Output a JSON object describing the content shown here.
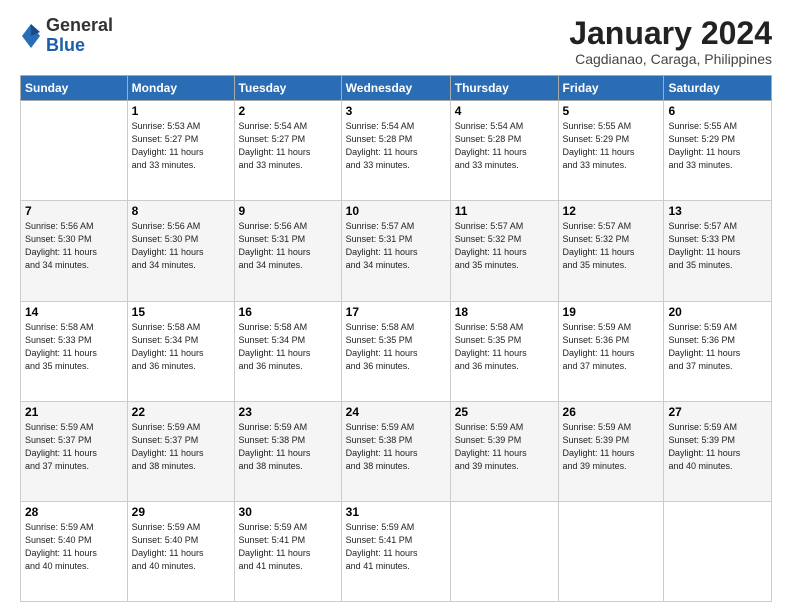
{
  "logo": {
    "general": "General",
    "blue": "Blue"
  },
  "header": {
    "month_year": "January 2024",
    "location": "Cagdianao, Caraga, Philippines"
  },
  "days_of_week": [
    "Sunday",
    "Monday",
    "Tuesday",
    "Wednesday",
    "Thursday",
    "Friday",
    "Saturday"
  ],
  "weeks": [
    [
      {
        "day": "",
        "sunrise": "",
        "sunset": "",
        "daylight": ""
      },
      {
        "day": "1",
        "sunrise": "Sunrise: 5:53 AM",
        "sunset": "Sunset: 5:27 PM",
        "daylight": "Daylight: 11 hours and 33 minutes."
      },
      {
        "day": "2",
        "sunrise": "Sunrise: 5:54 AM",
        "sunset": "Sunset: 5:27 PM",
        "daylight": "Daylight: 11 hours and 33 minutes."
      },
      {
        "day": "3",
        "sunrise": "Sunrise: 5:54 AM",
        "sunset": "Sunset: 5:28 PM",
        "daylight": "Daylight: 11 hours and 33 minutes."
      },
      {
        "day": "4",
        "sunrise": "Sunrise: 5:54 AM",
        "sunset": "Sunset: 5:28 PM",
        "daylight": "Daylight: 11 hours and 33 minutes."
      },
      {
        "day": "5",
        "sunrise": "Sunrise: 5:55 AM",
        "sunset": "Sunset: 5:29 PM",
        "daylight": "Daylight: 11 hours and 33 minutes."
      },
      {
        "day": "6",
        "sunrise": "Sunrise: 5:55 AM",
        "sunset": "Sunset: 5:29 PM",
        "daylight": "Daylight: 11 hours and 33 minutes."
      }
    ],
    [
      {
        "day": "7",
        "sunrise": "Sunrise: 5:56 AM",
        "sunset": "Sunset: 5:30 PM",
        "daylight": "Daylight: 11 hours and 34 minutes."
      },
      {
        "day": "8",
        "sunrise": "Sunrise: 5:56 AM",
        "sunset": "Sunset: 5:30 PM",
        "daylight": "Daylight: 11 hours and 34 minutes."
      },
      {
        "day": "9",
        "sunrise": "Sunrise: 5:56 AM",
        "sunset": "Sunset: 5:31 PM",
        "daylight": "Daylight: 11 hours and 34 minutes."
      },
      {
        "day": "10",
        "sunrise": "Sunrise: 5:57 AM",
        "sunset": "Sunset: 5:31 PM",
        "daylight": "Daylight: 11 hours and 34 minutes."
      },
      {
        "day": "11",
        "sunrise": "Sunrise: 5:57 AM",
        "sunset": "Sunset: 5:32 PM",
        "daylight": "Daylight: 11 hours and 35 minutes."
      },
      {
        "day": "12",
        "sunrise": "Sunrise: 5:57 AM",
        "sunset": "Sunset: 5:32 PM",
        "daylight": "Daylight: 11 hours and 35 minutes."
      },
      {
        "day": "13",
        "sunrise": "Sunrise: 5:57 AM",
        "sunset": "Sunset: 5:33 PM",
        "daylight": "Daylight: 11 hours and 35 minutes."
      }
    ],
    [
      {
        "day": "14",
        "sunrise": "Sunrise: 5:58 AM",
        "sunset": "Sunset: 5:33 PM",
        "daylight": "Daylight: 11 hours and 35 minutes."
      },
      {
        "day": "15",
        "sunrise": "Sunrise: 5:58 AM",
        "sunset": "Sunset: 5:34 PM",
        "daylight": "Daylight: 11 hours and 36 minutes."
      },
      {
        "day": "16",
        "sunrise": "Sunrise: 5:58 AM",
        "sunset": "Sunset: 5:34 PM",
        "daylight": "Daylight: 11 hours and 36 minutes."
      },
      {
        "day": "17",
        "sunrise": "Sunrise: 5:58 AM",
        "sunset": "Sunset: 5:35 PM",
        "daylight": "Daylight: 11 hours and 36 minutes."
      },
      {
        "day": "18",
        "sunrise": "Sunrise: 5:58 AM",
        "sunset": "Sunset: 5:35 PM",
        "daylight": "Daylight: 11 hours and 36 minutes."
      },
      {
        "day": "19",
        "sunrise": "Sunrise: 5:59 AM",
        "sunset": "Sunset: 5:36 PM",
        "daylight": "Daylight: 11 hours and 37 minutes."
      },
      {
        "day": "20",
        "sunrise": "Sunrise: 5:59 AM",
        "sunset": "Sunset: 5:36 PM",
        "daylight": "Daylight: 11 hours and 37 minutes."
      }
    ],
    [
      {
        "day": "21",
        "sunrise": "Sunrise: 5:59 AM",
        "sunset": "Sunset: 5:37 PM",
        "daylight": "Daylight: 11 hours and 37 minutes."
      },
      {
        "day": "22",
        "sunrise": "Sunrise: 5:59 AM",
        "sunset": "Sunset: 5:37 PM",
        "daylight": "Daylight: 11 hours and 38 minutes."
      },
      {
        "day": "23",
        "sunrise": "Sunrise: 5:59 AM",
        "sunset": "Sunset: 5:38 PM",
        "daylight": "Daylight: 11 hours and 38 minutes."
      },
      {
        "day": "24",
        "sunrise": "Sunrise: 5:59 AM",
        "sunset": "Sunset: 5:38 PM",
        "daylight": "Daylight: 11 hours and 38 minutes."
      },
      {
        "day": "25",
        "sunrise": "Sunrise: 5:59 AM",
        "sunset": "Sunset: 5:39 PM",
        "daylight": "Daylight: 11 hours and 39 minutes."
      },
      {
        "day": "26",
        "sunrise": "Sunrise: 5:59 AM",
        "sunset": "Sunset: 5:39 PM",
        "daylight": "Daylight: 11 hours and 39 minutes."
      },
      {
        "day": "27",
        "sunrise": "Sunrise: 5:59 AM",
        "sunset": "Sunset: 5:39 PM",
        "daylight": "Daylight: 11 hours and 40 minutes."
      }
    ],
    [
      {
        "day": "28",
        "sunrise": "Sunrise: 5:59 AM",
        "sunset": "Sunset: 5:40 PM",
        "daylight": "Daylight: 11 hours and 40 minutes."
      },
      {
        "day": "29",
        "sunrise": "Sunrise: 5:59 AM",
        "sunset": "Sunset: 5:40 PM",
        "daylight": "Daylight: 11 hours and 40 minutes."
      },
      {
        "day": "30",
        "sunrise": "Sunrise: 5:59 AM",
        "sunset": "Sunset: 5:41 PM",
        "daylight": "Daylight: 11 hours and 41 minutes."
      },
      {
        "day": "31",
        "sunrise": "Sunrise: 5:59 AM",
        "sunset": "Sunset: 5:41 PM",
        "daylight": "Daylight: 11 hours and 41 minutes."
      },
      {
        "day": "",
        "sunrise": "",
        "sunset": "",
        "daylight": ""
      },
      {
        "day": "",
        "sunrise": "",
        "sunset": "",
        "daylight": ""
      },
      {
        "day": "",
        "sunrise": "",
        "sunset": "",
        "daylight": ""
      }
    ]
  ]
}
